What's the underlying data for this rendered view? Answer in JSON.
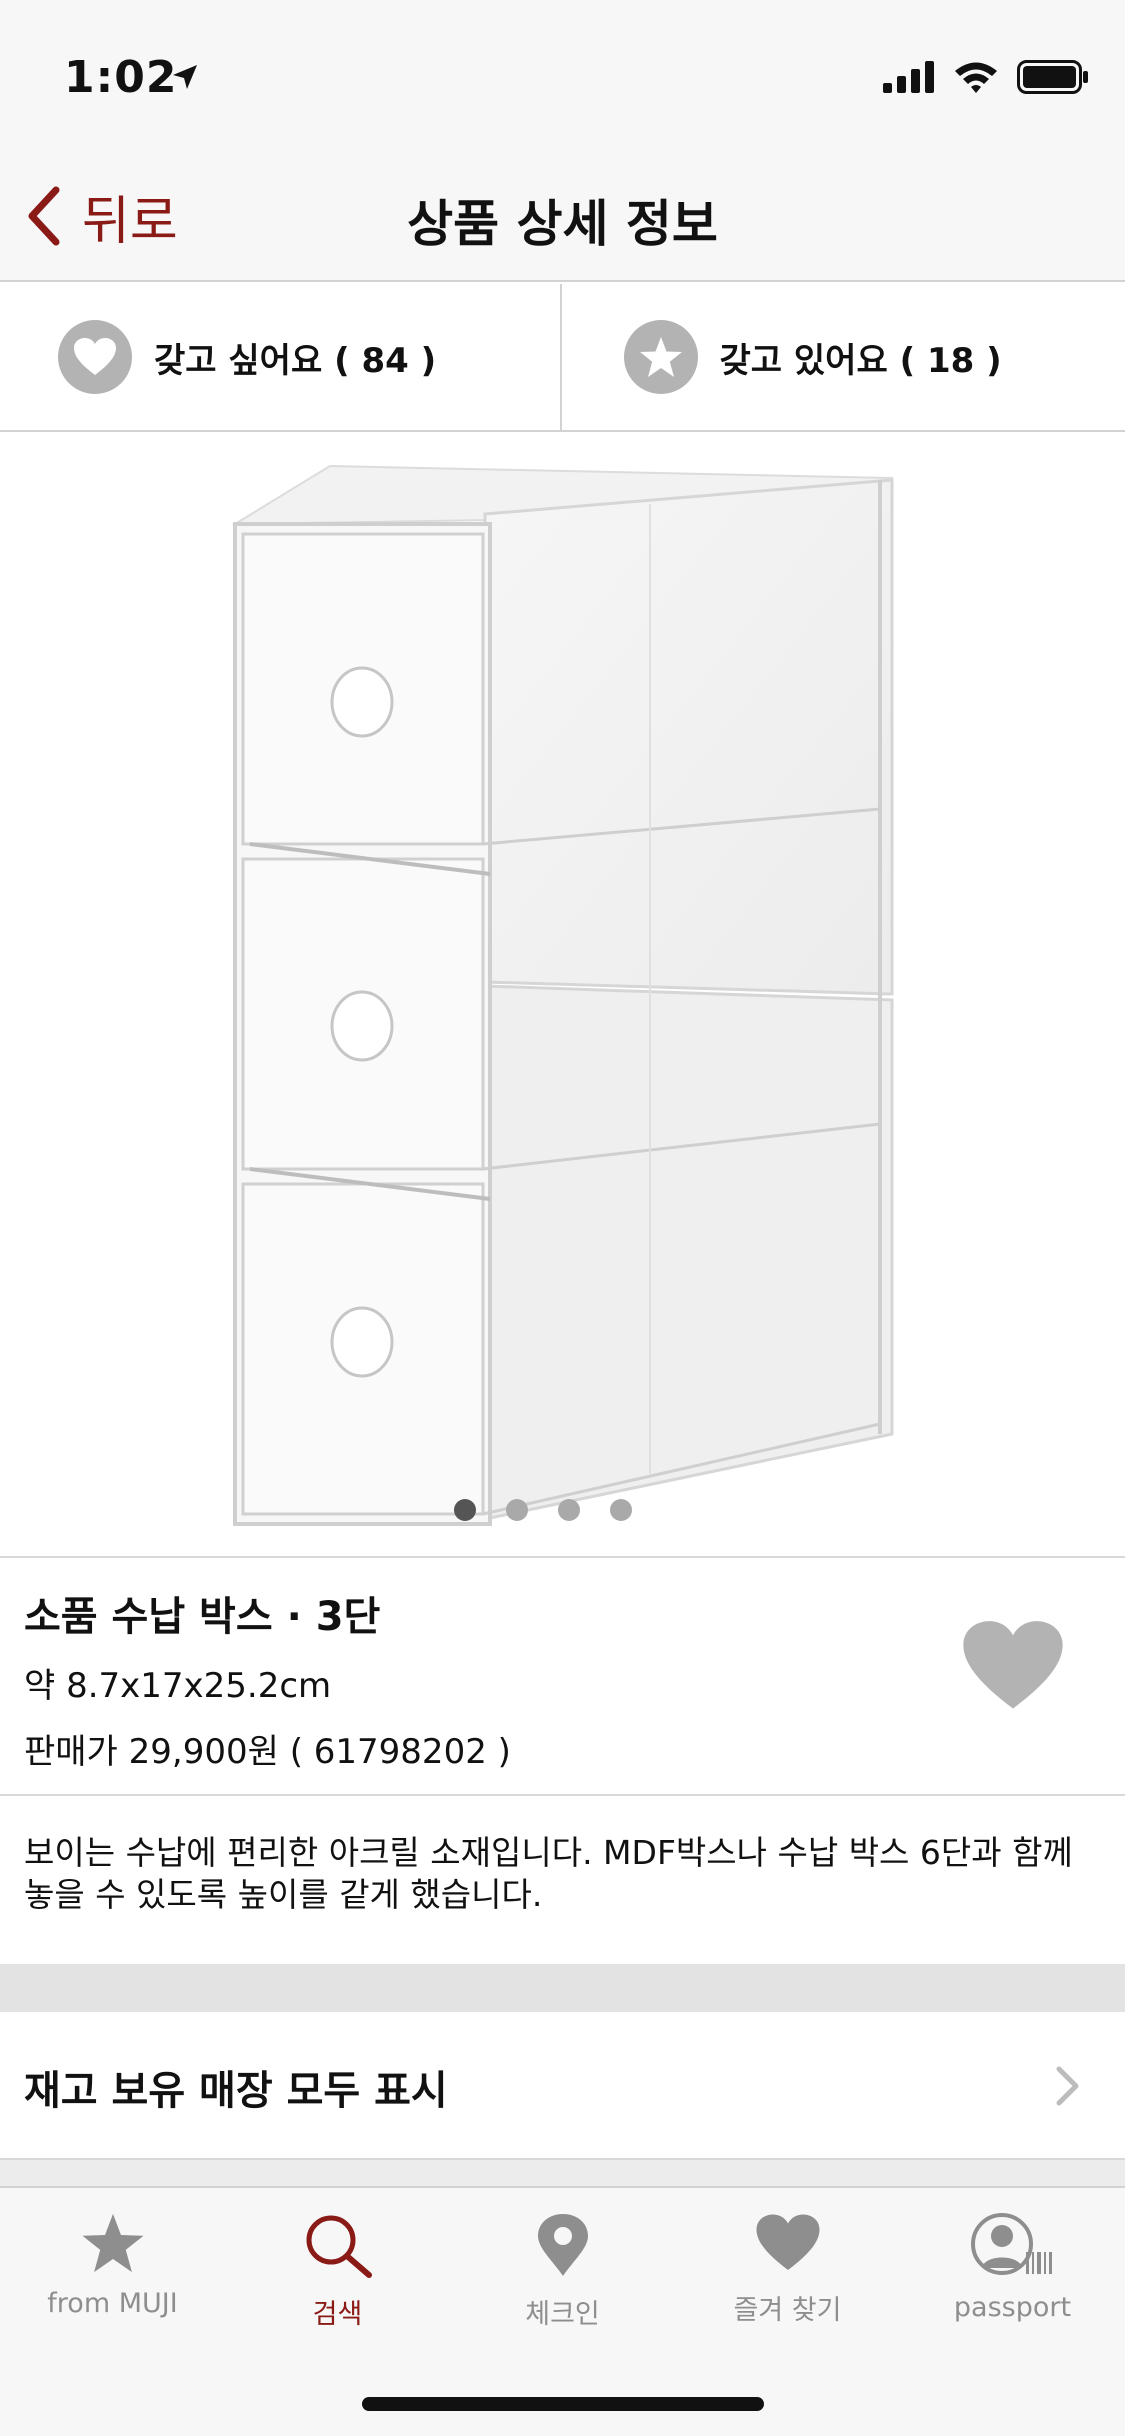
{
  "status_bar": {
    "time": "1:02"
  },
  "nav": {
    "back_label": "뒤로",
    "title": "상품 상세 정보"
  },
  "social": {
    "want_label": "갖고 싶어요 ( 84 )",
    "have_label": "갖고 있어요 ( 18 )"
  },
  "gallery": {
    "page_count": 4,
    "active_index": 0
  },
  "product": {
    "name": "소품 수납 박스 · 3단",
    "size": "약 8.7x17x25.2cm",
    "price": "판매가 29,900원 ( 61798202 )",
    "description_line1": "보이는 수납에 편리한 아크릴 소재입니다. MDF박스나 수납 박스 6단과 함께",
    "description_line2": "놓을 수 있도록 높이를 같게 했습니다."
  },
  "stock": {
    "label": "재고 보유 매장 모두 표시"
  },
  "tabs": [
    {
      "label": "from MUJI",
      "icon": "star-icon"
    },
    {
      "label": "검색",
      "icon": "search-icon",
      "active": true
    },
    {
      "label": "체크인",
      "icon": "map-pin-icon"
    },
    {
      "label": "즐겨 찾기",
      "icon": "heart-icon"
    },
    {
      "label": "passport",
      "icon": "passport-icon"
    }
  ],
  "colors": {
    "accent": "#8a1a16",
    "icon_gray": "#8e8e8e",
    "circle_gray": "#b3b3b3"
  }
}
